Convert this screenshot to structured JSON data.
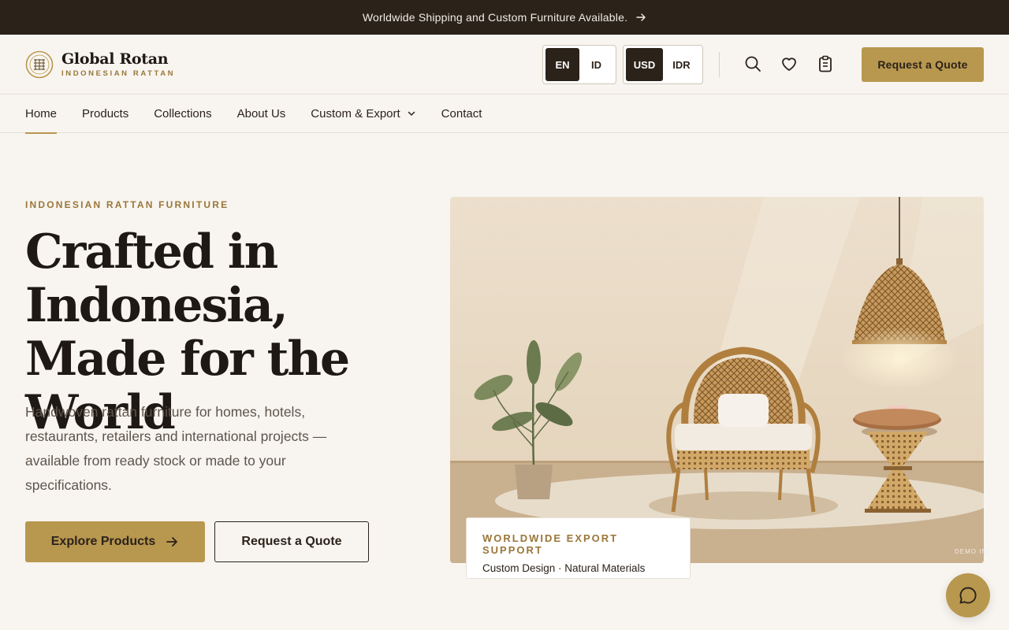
{
  "announcement": {
    "text": "Worldwide Shipping and Custom Furniture Available."
  },
  "brand": {
    "name": "Global Rotan",
    "tagline": "INDONESIAN RATTAN"
  },
  "language": {
    "options": [
      "EN",
      "ID"
    ],
    "selected": "EN"
  },
  "currency": {
    "options": [
      "USD",
      "IDR"
    ],
    "selected": "USD"
  },
  "header": {
    "icons": [
      "search-icon",
      "heart-icon",
      "clipboard-icon"
    ],
    "quote_label": "Request a Quote"
  },
  "nav": {
    "items": [
      {
        "label": "Home",
        "active": true
      },
      {
        "label": "Products"
      },
      {
        "label": "Collections"
      },
      {
        "label": "About Us"
      },
      {
        "label": "Custom & Export",
        "dropdown": true
      },
      {
        "label": "Contact"
      }
    ]
  },
  "hero": {
    "eyebrow": "INDONESIAN RATTAN FURNITURE",
    "title": "Crafted in Indonesia, Made for the World",
    "description": "Handwoven rattan furniture for homes, hotels, restaurants, retailers and international projects — available from ready stock or made to your specifications.",
    "primary_cta": "Explore Products",
    "secondary_cta": "Request a Quote",
    "image_tag": "DEMO IN"
  },
  "export_card": {
    "title": "WORLDWIDE EXPORT SUPPORT",
    "subtitle": "Custom Design · Natural Materials"
  },
  "colors": {
    "accent": "#b8974f",
    "dark": "#2b221a",
    "background": "#f8f5f0"
  }
}
